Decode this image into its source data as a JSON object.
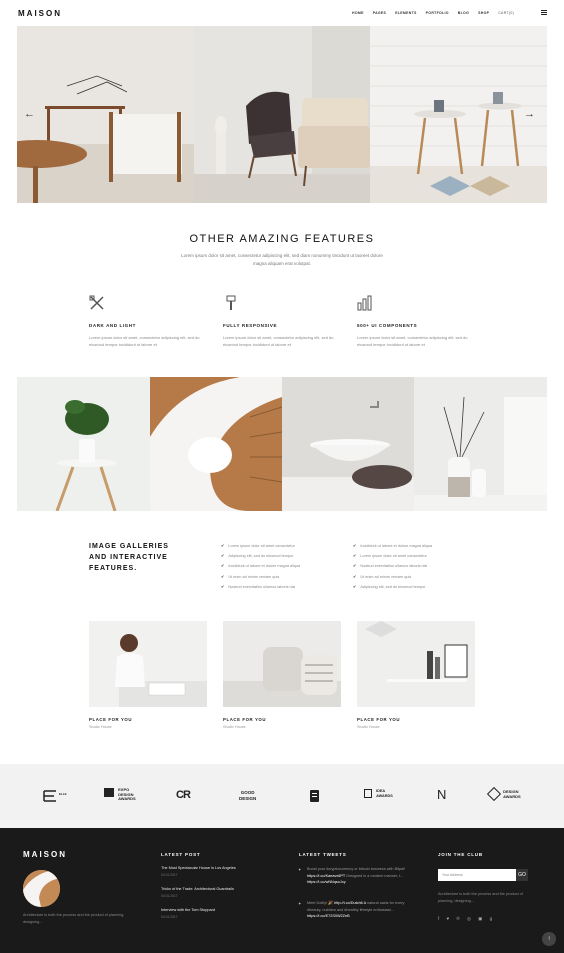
{
  "header": {
    "logo": "MAISON",
    "nav": [
      "HOME",
      "PAGES",
      "ELEMENTS",
      "PORTFOLIO",
      "BLOG",
      "SHOP"
    ],
    "cart": "CART(0)"
  },
  "hero": {
    "prev": "←",
    "next": "→"
  },
  "features": {
    "title": "OTHER AMAZING FEATURES",
    "subtitle": "Lorem ipsum dolor sit amet, consectetur adipiscing elit, sed diam nonummy tincidunt ut laoreet dolore magna aliquam erat volutpat.",
    "items": [
      {
        "title": "DARK AND LIGHT",
        "text": "Lorem ipsum dolor sit amet, consectetur adipiscing elit, sed do eiusmod tempor incididunt ut labore et"
      },
      {
        "title": "FULLY RESPONSIVE",
        "text": "Lorem ipsum dolor sit amet, consectetur adipiscing elit, sed do eiusmod tempor incididunt ut labore et"
      },
      {
        "title": "500+ UI COMPONENTS",
        "text": "Lorem ipsum dolor sit amet, consectetur adipiscing elit, sed do eiusmod tempor incididunt ut labore et"
      }
    ]
  },
  "image_galleries": {
    "title_lines": [
      "IMAGE GALLERIES",
      "AND INTERACTIVE",
      "FEATURES."
    ],
    "col1": [
      "Lorem ipsum dolor sit amet consectetur",
      "Adipiscing elit, sed do eiusmod tempor",
      "Incididunt ut labore et dolore magna aliqua",
      "Ut enim ad minim veniam quis",
      "Nostrud exercitation ullamco laboris nisi"
    ],
    "col2": [
      "Incididunt ut labore et dolore magna aliqua",
      "Lorem ipsum dolor sit amet consectetur",
      "Nostrud exercitation ullamco laboris nisi",
      "Ut enim ad minim veniam quis",
      "Adipiscing elit, sed do eiusmod tempor"
    ]
  },
  "places": [
    {
      "title": "PLACE FOR YOU",
      "sub": "Studio House"
    },
    {
      "title": "PLACE FOR YOU",
      "sub": "Studio House"
    },
    {
      "title": "PLACE FOR YOU",
      "sub": "Studio House"
    }
  ],
  "logos": {
    "expo": [
      "EXPO",
      "DESIGN",
      "AWARDS"
    ],
    "cr": "CR",
    "good": [
      "GOOD",
      "DESIGN"
    ],
    "idea": [
      "IDEA",
      "AWARDS"
    ],
    "n": "N",
    "design_awards": [
      "DESIGN",
      "AWARDS"
    ]
  },
  "footer": {
    "logo": "MAISON",
    "about": "Architecture is both the process and the product of planning, designing...",
    "latest_post": {
      "heading": "LATEST POST",
      "posts": [
        {
          "title": "The Most Spectacular House in Los Angeles",
          "date": "04.01.2017"
        },
        {
          "title": "Tricks of the Trade: Architectural Guardrails",
          "date": "04.01.2017"
        },
        {
          "title": "Interview with the Tom Stoppard",
          "date": "04.01.2017"
        }
      ]
    },
    "latest_tweets": {
      "heading": "LATEST TWEETS",
      "t1_a": "Boost your #cryptocurrency or bitcoin business with Bitpal! ",
      "t1_b": "https://t.co/Kaeavx6PT",
      "t1_c": " Designed in a modern manner, t... ",
      "t1_d": "https://t.co/wNNqsoJcy",
      "t2_a": "Meet Dotify! 🎉 ",
      "t2_b": "http://t.co/Dutch6 A",
      "t2_c": " natural oasis for every #beauty, nutrition and #healthy lifestyle enthusiast... ",
      "t2_d": "https://t.co/E72S0W2ZnB"
    },
    "join": {
      "heading": "JOIN THE CLUB",
      "placeholder": "Your Address",
      "button": "GO",
      "text": "Architecture is both the process and the product of planning, designing...",
      "socials": "f  ♥  ℗  ◎  ▣  g"
    },
    "to_top": "↑"
  },
  "colors": {
    "footer_bg": "#1a1a1a",
    "logos_bg": "#f2f2f2",
    "accent": "#111111"
  }
}
